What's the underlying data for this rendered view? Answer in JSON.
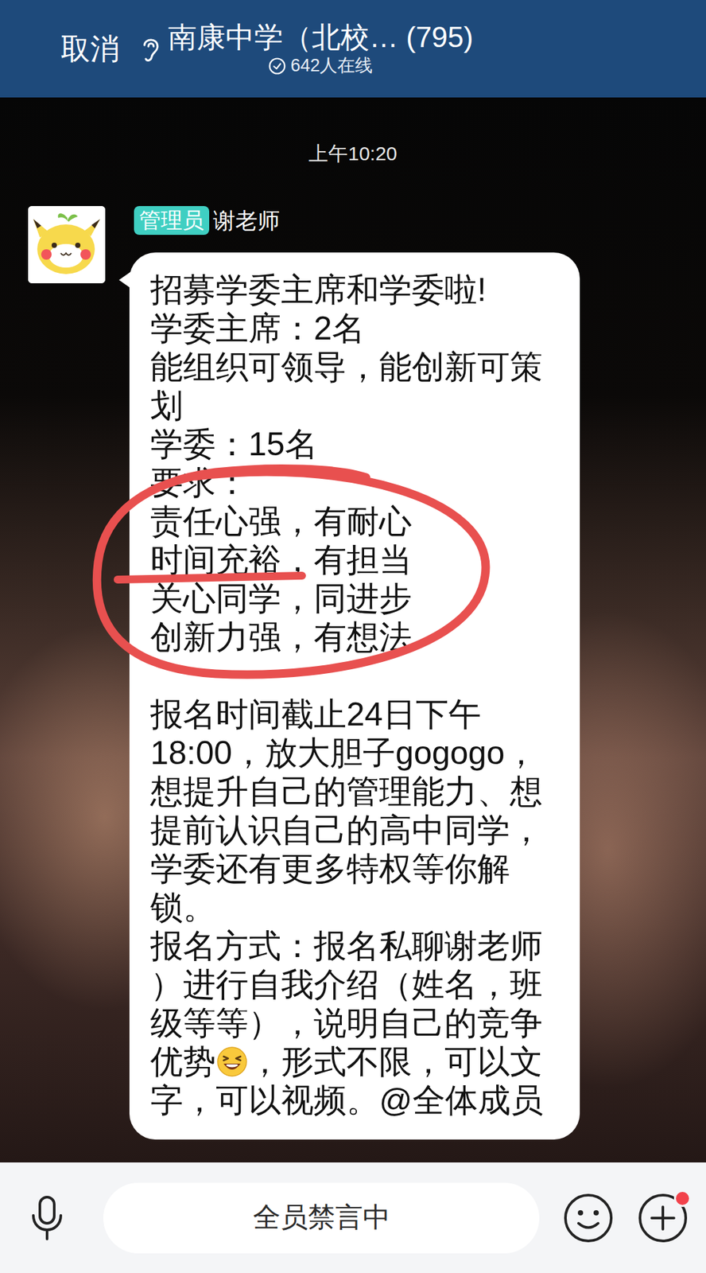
{
  "header": {
    "cancel": "取消",
    "title": "南康中学（北校… (795)",
    "online": "642人在线"
  },
  "timestamp": "上午10:20",
  "message": {
    "badge": "管理员",
    "sender": "谢老师",
    "paragraphs": [
      [
        [
          "招募学委主席和学委啦!"
        ],
        [
          "学委主席：2名"
        ],
        [
          "能组织可领导，能创新可策"
        ],
        [
          "划"
        ],
        [
          "学委：15名"
        ],
        [
          "要求："
        ],
        [
          "责任心强，有耐心"
        ],
        [
          "时间充裕，有担当"
        ],
        [
          "关心同学，同进步"
        ],
        [
          "创新力强，有想法"
        ]
      ],
      [
        [
          "报名时间截止24日下午"
        ],
        [
          "18:00，放大胆子gogogo，"
        ],
        [
          "想提升自己的管理能力、想"
        ],
        [
          "提前认识自己的高中同学，"
        ],
        [
          "学委还有更多特权等你解"
        ],
        [
          "锁。"
        ],
        [
          "报名方式：报名私聊谢老师"
        ],
        [
          "）进行自我介绍（姓名，班"
        ],
        [
          "级等等），说明自己的竞争"
        ],
        [
          "优势",
          "，形式不限，可以文"
        ],
        [
          "字，可以视频。@全体成员"
        ]
      ]
    ]
  },
  "input": {
    "text": "全员禁言中",
    "disabled": true
  },
  "plus_button": {
    "has_notification": true
  }
}
